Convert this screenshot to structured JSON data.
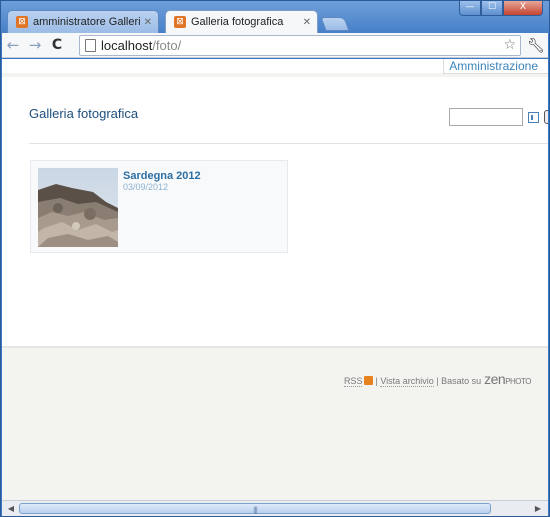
{
  "window": {
    "caption_buttons": {
      "minimize": "—",
      "maximize": "☐",
      "close": "X"
    }
  },
  "tabs": [
    {
      "title": "amministratore Galleria fot",
      "icon": "zenphoto-favicon",
      "active": false
    },
    {
      "title": "Galleria fotografica",
      "icon": "zenphoto-favicon",
      "active": true
    }
  ],
  "toolbar": {
    "back_icon": "←",
    "forward_icon": "→",
    "reload_icon": "C",
    "url_host": "localhost",
    "url_path": "/foto/",
    "star_icon": "☆",
    "wrench_icon": "🔧"
  },
  "page": {
    "admin_link": "Amministrazione",
    "gallery_title": "Galleria fotografica",
    "search": {
      "value": "",
      "placeholder": ""
    },
    "albums": [
      {
        "title": "Sardegna 2012",
        "date": "03/09/2012"
      }
    ],
    "footer": {
      "rss": "RSS",
      "sep1": "|",
      "archive": "Vista archivio",
      "sep2": "|",
      "powered": "Basato su",
      "zen": "ZEN",
      "photo": "PHOTO"
    }
  },
  "scrollbar": {
    "left_arrow": "◀",
    "right_arrow": "▶",
    "grip": "|||"
  },
  "colors": {
    "link_blue": "#3a84b9",
    "title_blue": "#1e4f7d",
    "rss_orange": "#e8821e",
    "favicon_orange": "#e07525"
  }
}
